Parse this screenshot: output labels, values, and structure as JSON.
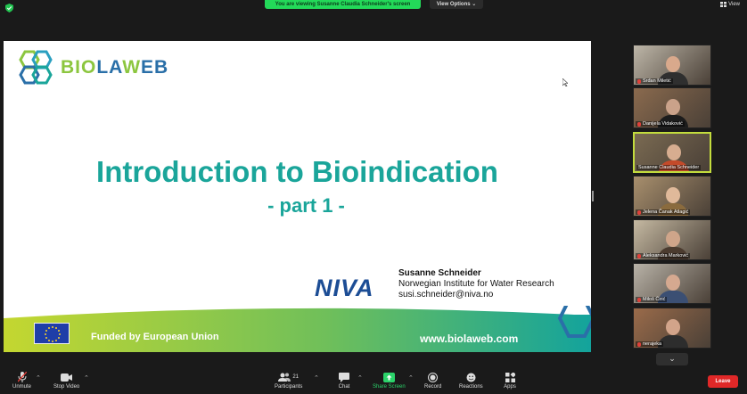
{
  "top_bar": {
    "share_banner": "You are viewing Susanne Claudia Schneider's screen",
    "view_options": "View Options ⌄",
    "view_label": "View"
  },
  "slide": {
    "logo_bio": "BIO",
    "logo_la": "LA",
    "logo_w": "W",
    "logo_eb": "EB",
    "title": "Introduction to Bioindication",
    "subtitle": "- part 1 -",
    "niva_logo": "NIVA",
    "author_name": "Susanne Schneider",
    "author_org": "Norwegian Institute for Water Research",
    "author_email": "susi.schneider@niva.no",
    "funded": "Funded by European Union",
    "website": "www.biolaweb.com",
    "colors": {
      "title": "#1aa59a",
      "niva": "#1c4d95",
      "band_start": "#c4d730",
      "band_end": "#13a39c"
    }
  },
  "participants": [
    {
      "name": "Srđan Miletić",
      "muted": true,
      "active": false
    },
    {
      "name": "Danijela Vidaković",
      "muted": true,
      "active": false
    },
    {
      "name": "Susanne Claudia Schneider",
      "muted": false,
      "active": true
    },
    {
      "name": "Jelena Čanak Atlagić",
      "muted": true,
      "active": false
    },
    {
      "name": "Aleksandra Marković",
      "muted": true,
      "active": false
    },
    {
      "name": "Miloš Ćirić",
      "muted": true,
      "active": false
    },
    {
      "name": "nerajeka",
      "muted": true,
      "active": false
    }
  ],
  "scroll_down": "⌄",
  "toolbar": {
    "unmute": "Unmute",
    "stop_video": "Stop Video",
    "participants": "Participants",
    "participants_count": "21",
    "chat": "Chat",
    "share_screen": "Share Screen",
    "record": "Record",
    "reactions": "Reactions",
    "apps": "Apps",
    "leave": "Leave"
  }
}
